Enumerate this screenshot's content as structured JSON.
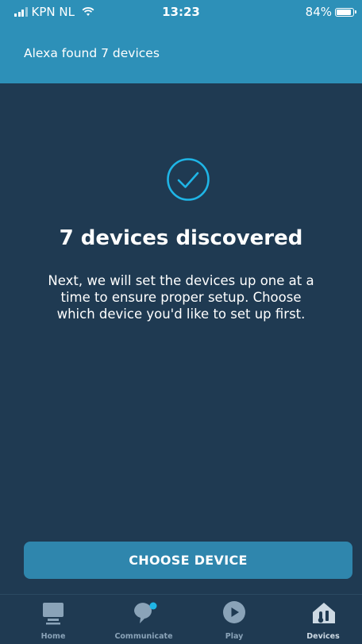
{
  "status_bar": {
    "carrier": "KPN NL",
    "time": "13:23",
    "battery": "84%"
  },
  "header": {
    "title": "Alexa found 7 devices"
  },
  "main": {
    "icon": "check-circle-icon",
    "title": "7 devices discovered",
    "description": "Next, we will set the devices up one at a time to ensure proper setup. Choose which device you'd like to set up first."
  },
  "actions": {
    "choose_device_label": "CHOOSE DEVICE"
  },
  "nav": {
    "items": [
      {
        "label": "Home",
        "icon": "home-icon"
      },
      {
        "label": "Communicate",
        "icon": "communicate-icon"
      },
      {
        "label": "Play",
        "icon": "play-icon"
      },
      {
        "label": "Devices",
        "icon": "devices-icon"
      }
    ]
  },
  "colors": {
    "background": "#1f3a52",
    "header": "#2d90b8",
    "button": "#2f86ad",
    "accent": "#1fb5e6",
    "notification_dot": "#1fb5e6"
  }
}
